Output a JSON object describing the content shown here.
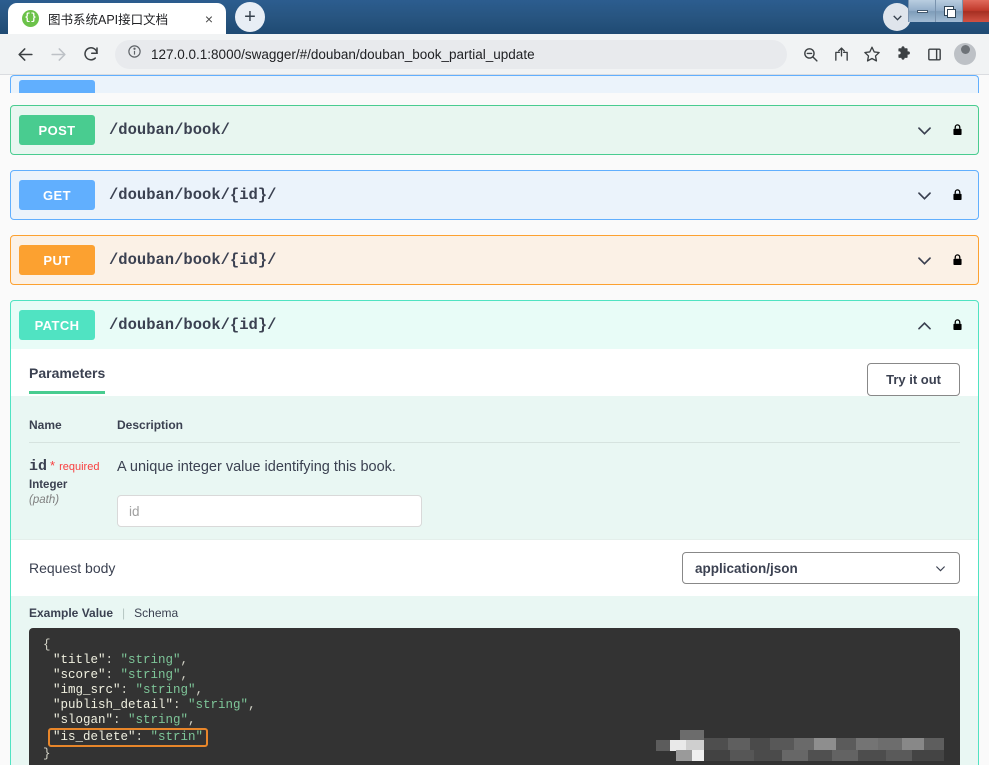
{
  "browser": {
    "tab": {
      "title": "图书系统API接口文档",
      "favicon": "swagger-braces-icon",
      "close_label": "×"
    },
    "new_tab_label": "+",
    "url": "127.0.0.1:8000/swagger/#/douban/douban_book_partial_update",
    "toolbar_icons": [
      "back-icon",
      "forward-icon",
      "reload-icon",
      "site-info-icon",
      "zoom-out-icon",
      "share-icon",
      "bookmark-star-icon",
      "extensions-icon",
      "side-panel-icon",
      "profile-avatar-icon"
    ],
    "window_controls": [
      "minimize",
      "restore",
      "close"
    ]
  },
  "operations": [
    {
      "method": "POST",
      "path": "/douban/book/",
      "expanded": false,
      "color": "#49cc90"
    },
    {
      "method": "GET",
      "path": "/douban/book/{id}/",
      "expanded": false,
      "color": "#61affe"
    },
    {
      "method": "PUT",
      "path": "/douban/book/{id}/",
      "expanded": false,
      "color": "#fca130"
    },
    {
      "method": "PATCH",
      "path": "/douban/book/{id}/",
      "expanded": true,
      "color": "#50e3c2"
    }
  ],
  "patch_panel": {
    "tab_parameters": "Parameters",
    "try_it_out": "Try it out",
    "table_headers": {
      "name": "Name",
      "description": "Description"
    },
    "parameter": {
      "name": "id",
      "required_star": "*",
      "required_label": "required",
      "type": "Integer",
      "location": "(path)",
      "description": "A unique integer value identifying this book.",
      "input_placeholder": "id",
      "input_value": ""
    },
    "request_body_label": "Request body",
    "content_type_selected": "application/json",
    "example_tabs": {
      "active": "Example Value",
      "separator": "|",
      "inactive": "Schema"
    },
    "example_code": {
      "open_brace": "{",
      "close_brace": "}",
      "lines": [
        {
          "key": "\"title\"",
          "sep": ": ",
          "value": "\"string\"",
          "comma": ",",
          "highlighted": false
        },
        {
          "key": "\"score\"",
          "sep": ": ",
          "value": "\"string\"",
          "comma": ",",
          "highlighted": false
        },
        {
          "key": "\"img_src\"",
          "sep": ": ",
          "value": "\"string\"",
          "comma": ",",
          "highlighted": false
        },
        {
          "key": "\"publish_detail\"",
          "sep": ": ",
          "value": "\"string\"",
          "comma": ",",
          "highlighted": false
        },
        {
          "key": "\"slogan\"",
          "sep": ": ",
          "value": "\"string\"",
          "comma": ",",
          "highlighted": false
        },
        {
          "key": "\"is_delete\"",
          "sep": ": ",
          "value": "\"strin\"",
          "comma": "",
          "highlighted": true
        }
      ],
      "highlight_color": "#e8862a"
    }
  },
  "colors": {
    "post": "#49cc90",
    "get": "#61affe",
    "put": "#fca130",
    "patch": "#50e3c2",
    "required": "#f93e3e",
    "code_bg": "#333333",
    "code_value": "#7ec699"
  }
}
